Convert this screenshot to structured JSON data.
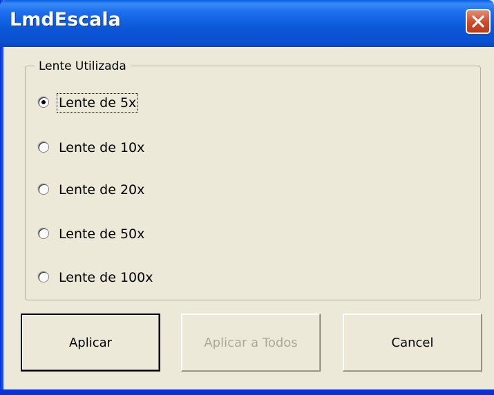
{
  "window": {
    "title": "LmdEscala",
    "close_icon": "close-icon"
  },
  "group": {
    "legend": "Lente Utilizada",
    "options": [
      {
        "label": "Lente de 5x",
        "selected": true
      },
      {
        "label": "Lente de 10x",
        "selected": false
      },
      {
        "label": "Lente de 20x",
        "selected": false
      },
      {
        "label": "Lente de 50x",
        "selected": false
      },
      {
        "label": "Lente de 100x",
        "selected": false
      }
    ]
  },
  "buttons": {
    "apply": "Aplicar",
    "apply_all": "Aplicar a Todos",
    "cancel": "Cancel"
  },
  "colors": {
    "titlebar": "#0A58D8",
    "close": "#CE4B2C",
    "dialog_bg": "#ECE9D8",
    "disabled_text": "#ACA899"
  }
}
